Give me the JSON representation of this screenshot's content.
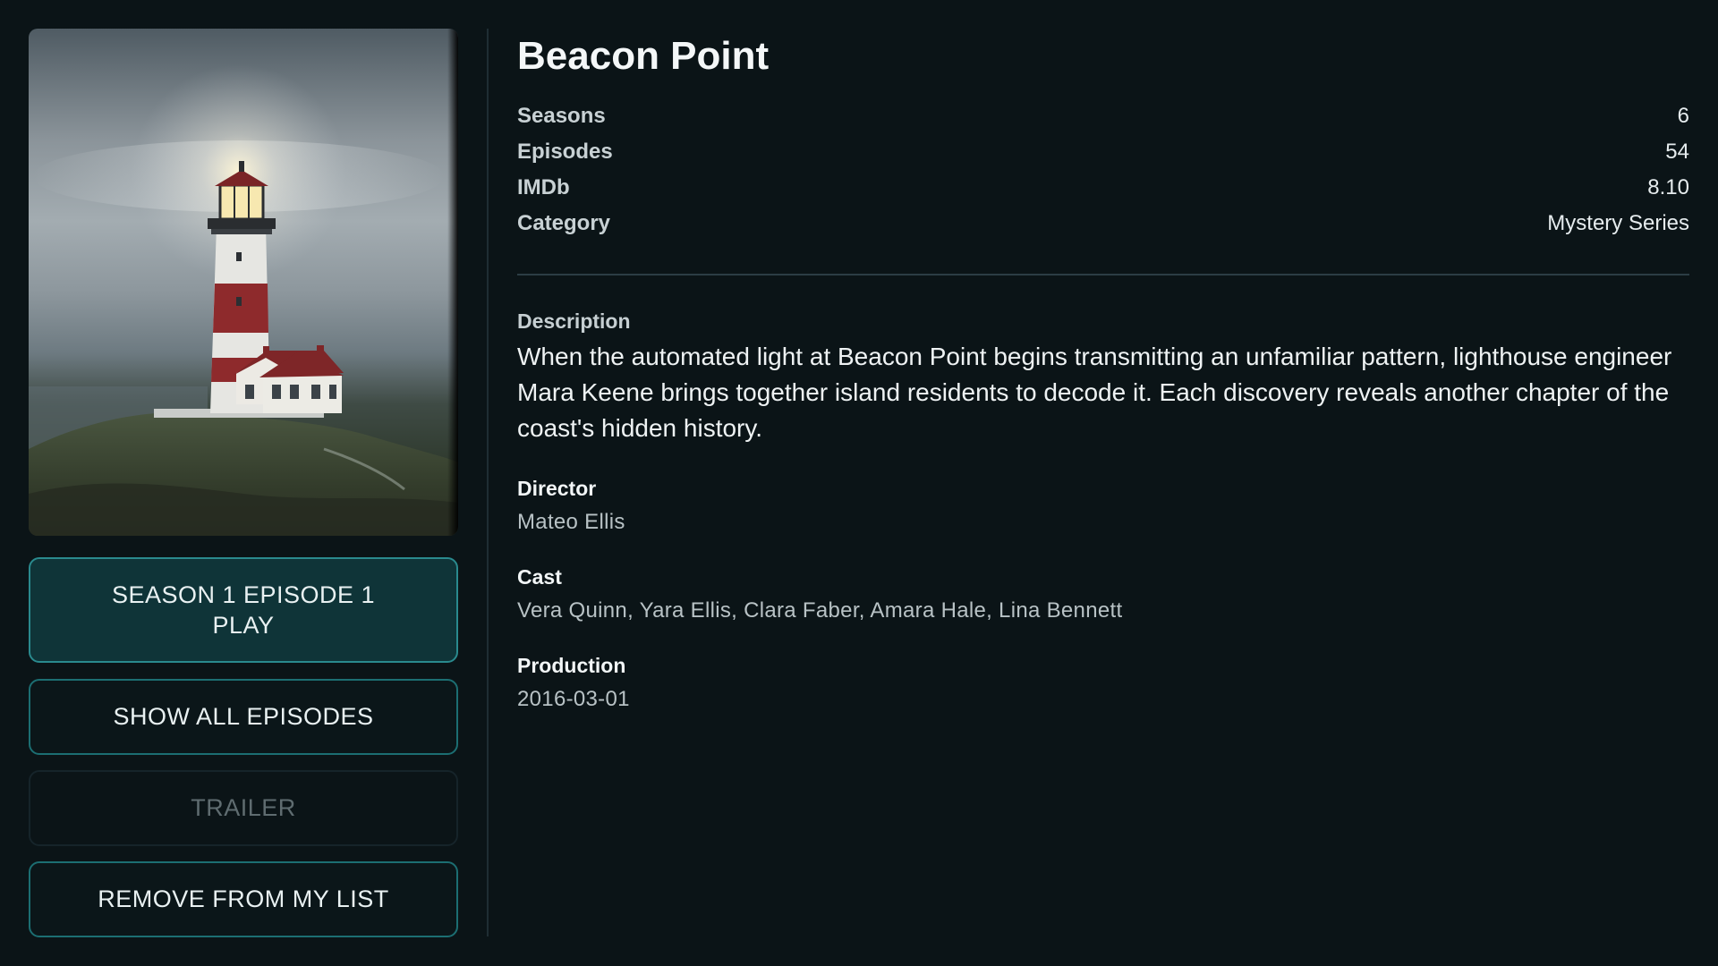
{
  "show": {
    "title": "Beacon Point",
    "poster_alt": "lighthouse-poster"
  },
  "meta": [
    {
      "label": "Seasons",
      "value": "6"
    },
    {
      "label": "Episodes",
      "value": "54"
    },
    {
      "label": "IMDb",
      "value": "8.10"
    },
    {
      "label": "Category",
      "value": "Mystery Series"
    }
  ],
  "description": {
    "label": "Description",
    "text": "When the automated light at Beacon Point begins transmitting an unfamiliar pattern, lighthouse engineer Mara Keene brings together island residents to decode it. Each discovery reveals another chapter of the coast's hidden history."
  },
  "director": {
    "label": "Director",
    "value": "Mateo Ellis"
  },
  "cast": {
    "label": "Cast",
    "value": "Vera Quinn, Yara Ellis, Clara Faber, Amara Hale, Lina Bennett"
  },
  "production": {
    "label": "Production",
    "value": "2016-03-01"
  },
  "buttons": {
    "play_line1": "SEASON 1 EPISODE 1",
    "play_line2": "PLAY",
    "episodes": "SHOW ALL EPISODES",
    "trailer": "TRAILER",
    "remove": "REMOVE FROM MY LIST"
  },
  "colors": {
    "background": "#0b1417",
    "accent": "#2a8a8e",
    "primary_button_bg": "#0f3438",
    "disabled_text": "#5f6c70"
  }
}
